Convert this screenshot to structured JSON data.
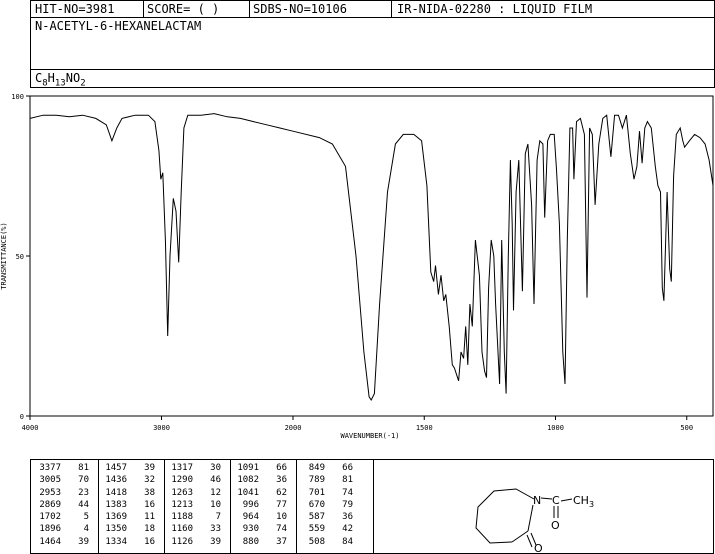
{
  "header": {
    "hit_no": "HIT-NO=3981",
    "score": "SCORE=  (   )",
    "sdbs_no": "SDBS-NO=10106",
    "ir_info": "IR-NIDA-02280 : LIQUID FILM",
    "compound_name": "N-ACETYL-6-HEXANELACTAM",
    "formula_parts": {
      "c": "C",
      "c_n": "8",
      "h": "H",
      "h_n": "13",
      "rest": "NO",
      "o_n": "2"
    }
  },
  "chart_data": {
    "type": "line",
    "title": "",
    "xlabel": "WAVENUMBER(-1)",
    "ylabel": "TRANSMITTANCE(%)",
    "xlim": [
      4000,
      400
    ],
    "ylim": [
      0,
      100
    ],
    "x_ticks": [
      "4000",
      "3000",
      "2000",
      "1500",
      "1000",
      "500"
    ],
    "y_ticks": [
      "100",
      "50",
      "0"
    ],
    "grid": false,
    "series": [
      {
        "values": [
          [
            4000,
            93
          ],
          [
            3900,
            94
          ],
          [
            3800,
            94
          ],
          [
            3700,
            93.5
          ],
          [
            3600,
            94
          ],
          [
            3500,
            93
          ],
          [
            3420,
            91
          ],
          [
            3377,
            86
          ],
          [
            3340,
            90
          ],
          [
            3300,
            93
          ],
          [
            3200,
            94
          ],
          [
            3100,
            94
          ],
          [
            3050,
            92
          ],
          [
            3020,
            83
          ],
          [
            3005,
            74
          ],
          [
            2990,
            76
          ],
          [
            2970,
            55
          ],
          [
            2953,
            25
          ],
          [
            2935,
            50
          ],
          [
            2910,
            68
          ],
          [
            2890,
            64
          ],
          [
            2869,
            48
          ],
          [
            2850,
            70
          ],
          [
            2830,
            90
          ],
          [
            2800,
            94
          ],
          [
            2700,
            94
          ],
          [
            2600,
            94.5
          ],
          [
            2500,
            93.5
          ],
          [
            2400,
            93
          ],
          [
            2300,
            92
          ],
          [
            2200,
            91
          ],
          [
            2100,
            90
          ],
          [
            2000,
            89
          ],
          [
            1900,
            87
          ],
          [
            1850,
            85
          ],
          [
            1800,
            78
          ],
          [
            1760,
            50
          ],
          [
            1730,
            20
          ],
          [
            1710,
            6
          ],
          [
            1702,
            5
          ],
          [
            1690,
            7
          ],
          [
            1670,
            35
          ],
          [
            1640,
            70
          ],
          [
            1610,
            85
          ],
          [
            1580,
            88
          ],
          [
            1540,
            88
          ],
          [
            1510,
            86
          ],
          [
            1490,
            72
          ],
          [
            1475,
            45
          ],
          [
            1464,
            42
          ],
          [
            1457,
            47
          ],
          [
            1446,
            38
          ],
          [
            1436,
            44
          ],
          [
            1426,
            36
          ],
          [
            1418,
            38
          ],
          [
            1405,
            28
          ],
          [
            1393,
            16
          ],
          [
            1385,
            15
          ],
          [
            1369,
            11
          ],
          [
            1360,
            20
          ],
          [
            1350,
            18
          ],
          [
            1342,
            28
          ],
          [
            1334,
            16
          ],
          [
            1326,
            35
          ],
          [
            1317,
            28
          ],
          [
            1305,
            55
          ],
          [
            1290,
            44
          ],
          [
            1280,
            20
          ],
          [
            1270,
            14
          ],
          [
            1263,
            12
          ],
          [
            1255,
            40
          ],
          [
            1245,
            55
          ],
          [
            1235,
            50
          ],
          [
            1228,
            35
          ],
          [
            1213,
            10
          ],
          [
            1205,
            55
          ],
          [
            1195,
            20
          ],
          [
            1188,
            7
          ],
          [
            1180,
            50
          ],
          [
            1172,
            80
          ],
          [
            1165,
            60
          ],
          [
            1160,
            33
          ],
          [
            1150,
            70
          ],
          [
            1140,
            80
          ],
          [
            1126,
            39
          ],
          [
            1115,
            82
          ],
          [
            1105,
            85
          ],
          [
            1091,
            66
          ],
          [
            1082,
            35
          ],
          [
            1070,
            80
          ],
          [
            1060,
            86
          ],
          [
            1048,
            85
          ],
          [
            1041,
            62
          ],
          [
            1030,
            86
          ],
          [
            1020,
            88
          ],
          [
            1005,
            88
          ],
          [
            996,
            77
          ],
          [
            985,
            60
          ],
          [
            972,
            20
          ],
          [
            964,
            10
          ],
          [
            955,
            55
          ],
          [
            945,
            90
          ],
          [
            935,
            90
          ],
          [
            930,
            74
          ],
          [
            920,
            92
          ],
          [
            905,
            93
          ],
          [
            890,
            88
          ],
          [
            880,
            37
          ],
          [
            870,
            90
          ],
          [
            860,
            88
          ],
          [
            849,
            66
          ],
          [
            835,
            85
          ],
          [
            820,
            93
          ],
          [
            805,
            94
          ],
          [
            789,
            81
          ],
          [
            775,
            94
          ],
          [
            760,
            94
          ],
          [
            745,
            90
          ],
          [
            730,
            94
          ],
          [
            715,
            82
          ],
          [
            701,
            74
          ],
          [
            690,
            78
          ],
          [
            680,
            89
          ],
          [
            670,
            79
          ],
          [
            660,
            90
          ],
          [
            650,
            92
          ],
          [
            635,
            90
          ],
          [
            620,
            78
          ],
          [
            610,
            72
          ],
          [
            600,
            70
          ],
          [
            593,
            40
          ],
          [
            587,
            36
          ],
          [
            575,
            70
          ],
          [
            565,
            46
          ],
          [
            559,
            42
          ],
          [
            550,
            75
          ],
          [
            540,
            88
          ],
          [
            525,
            90
          ],
          [
            515,
            86
          ],
          [
            508,
            84
          ],
          [
            490,
            86
          ],
          [
            470,
            88
          ],
          [
            450,
            87
          ],
          [
            430,
            85
          ],
          [
            415,
            80
          ],
          [
            400,
            72
          ]
        ]
      }
    ],
    "peak_table": {
      "columns": [
        [
          [
            "3377",
            "81"
          ],
          [
            "3005",
            "70"
          ],
          [
            "2953",
            "23"
          ],
          [
            "2869",
            "44"
          ],
          [
            "1702",
            "5"
          ],
          [
            "1896",
            "4"
          ],
          [
            "1464",
            "39"
          ]
        ],
        [
          [
            "1457",
            "39"
          ],
          [
            "1436",
            "32"
          ],
          [
            "1418",
            "38"
          ],
          [
            "1383",
            "16"
          ],
          [
            "1369",
            "11"
          ],
          [
            "1350",
            "18"
          ],
          [
            "1334",
            "16"
          ]
        ],
        [
          [
            "1317",
            "30"
          ],
          [
            "1290",
            "46"
          ],
          [
            "1263",
            "12"
          ],
          [
            "1213",
            "10"
          ],
          [
            "1188",
            "7"
          ],
          [
            "1160",
            "33"
          ],
          [
            "1126",
            "39"
          ]
        ],
        [
          [
            "1091",
            "66"
          ],
          [
            "1082",
            "36"
          ],
          [
            "1041",
            "62"
          ],
          [
            "996",
            "77"
          ],
          [
            "964",
            "10"
          ],
          [
            "930",
            "74"
          ],
          [
            "880",
            "37"
          ]
        ],
        [
          [
            "849",
            "66"
          ],
          [
            "789",
            "81"
          ],
          [
            "701",
            "74"
          ],
          [
            "670",
            "79"
          ],
          [
            "587",
            "36"
          ],
          [
            "559",
            "42"
          ],
          [
            "508",
            "84"
          ]
        ]
      ]
    }
  },
  "structure": {
    "n": "N",
    "o1": "O",
    "o2": "O",
    "ch3": "CH",
    "ch3_sub": "3",
    "c": "C"
  }
}
